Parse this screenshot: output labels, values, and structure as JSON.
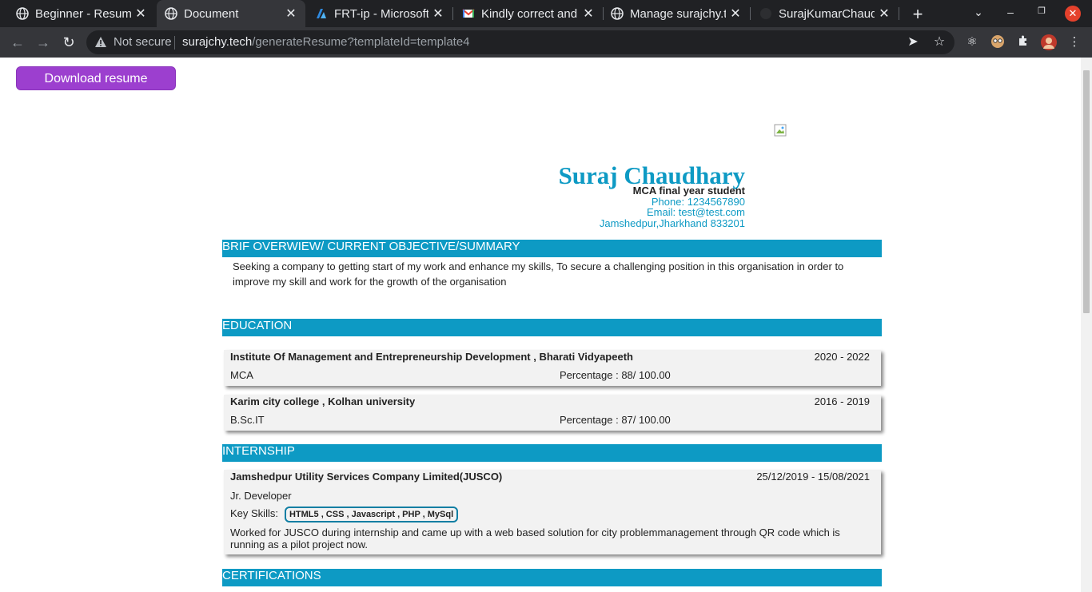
{
  "browser": {
    "tabs": [
      {
        "title": "Beginner - Resume",
        "favicon": "globe-icon",
        "active": false
      },
      {
        "title": "Document",
        "favicon": "globe-icon",
        "active": true
      },
      {
        "title": "FRT-ip - Microsoft",
        "favicon": "azure-icon",
        "active": false
      },
      {
        "title": "Kindly correct and",
        "favicon": "gmail-icon",
        "active": false
      },
      {
        "title": "Manage surajchy.t",
        "favicon": "globe-icon",
        "active": false
      },
      {
        "title": "SurajKumarChaud",
        "favicon": "github-icon",
        "active": false
      }
    ],
    "security_label": "Not secure",
    "url_host": "surajchy.tech",
    "url_path": "/generateResume?templateId=template4"
  },
  "page": {
    "download_label": "Download resume",
    "name": "Suraj Chaudhary",
    "subtitle": "MCA final year student",
    "phone": "Phone: 1234567890",
    "email": "Email: test@test.com",
    "address": "Jamshedpur,Jharkhand 833201",
    "sections": {
      "summary_title": "BRIF OVERWIEW/ CURRENT OBJECTIVE/SUMMARY",
      "education_title": "EDUCATION",
      "internship_title": "INTERNSHIP",
      "certifications_title": "CERTIFICATIONS"
    },
    "summary_text": "Seeking a company to getting start of my work and enhance my skills, To secure a challenging position in this organisation in order to improve my skill and work for the growth of the organisation",
    "education": [
      {
        "institute": "Institute Of Management and Entrepreneurship Development , Bharati Vidyapeeth",
        "years": "2020 - 2022",
        "degree": "MCA",
        "percentage": "Percentage : 88/ 100.00"
      },
      {
        "institute": "Karim city college , Kolhan university",
        "years": "2016 - 2019",
        "degree": "B.Sc.IT",
        "percentage": "Percentage : 87/ 100.00"
      }
    ],
    "internship": {
      "company": "Jamshedpur Utility Services Company Limited(JUSCO)",
      "dates": "25/12/2019 - 15/08/2021",
      "role": "Jr. Developer",
      "skills_label": "Key Skills:",
      "skills": "HTML5 , CSS , Javascript , PHP , MySql",
      "description": "Worked for JUSCO during internship and came up with a web based solution for city problemmanagement through QR code which is running as a pilot project now."
    }
  }
}
